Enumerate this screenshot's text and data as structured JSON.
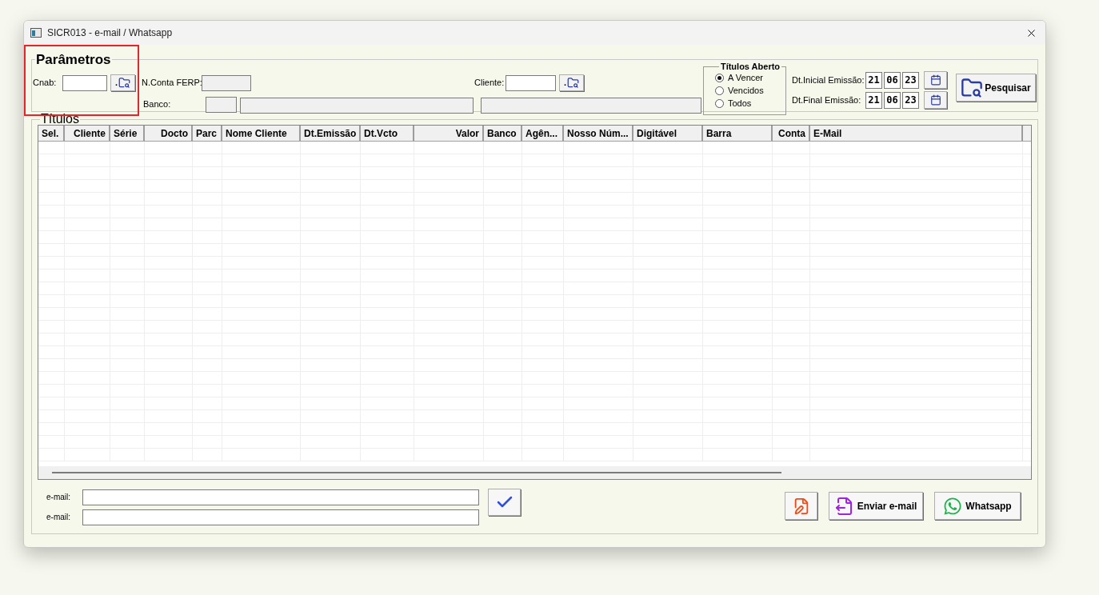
{
  "window": {
    "title": "SICR013 - e-mail / Whatsapp"
  },
  "parametros": {
    "title": "Parâmetros",
    "cnab": {
      "label": "Cnab:",
      "button": "."
    },
    "conta": {
      "label": "N.Conta FERP:"
    },
    "banco": {
      "label": "Banco:"
    },
    "cliente": {
      "label": "Cliente:",
      "button": "."
    },
    "titulos_aberto": {
      "title": "Títulos Aberto",
      "options": [
        {
          "label": "A Vencer",
          "selected": true
        },
        {
          "label": "Vencidos",
          "selected": false
        },
        {
          "label": "Todos",
          "selected": false
        }
      ]
    },
    "datas": [
      {
        "label": "Dt.Inicial Emissão:",
        "day": "21",
        "month": "06",
        "year": "23"
      },
      {
        "label": "Dt.Final Emissão:",
        "day": "21",
        "month": "06",
        "year": "23"
      }
    ],
    "search_button": "Pesquisar"
  },
  "titulos": {
    "title": "Títulos",
    "columns": [
      {
        "label": "Sel.",
        "kind": "text"
      },
      {
        "label": "Cliente",
        "kind": "number"
      },
      {
        "label": "Série",
        "kind": "text"
      },
      {
        "label": "Docto",
        "kind": "number"
      },
      {
        "label": "Parc",
        "kind": "text"
      },
      {
        "label": "Nome Cliente",
        "kind": "text"
      },
      {
        "label": "Dt.Emissão",
        "kind": "text"
      },
      {
        "label": "Dt.Vcto",
        "kind": "text"
      },
      {
        "label": "Valor",
        "kind": "number"
      },
      {
        "label": "Banco",
        "kind": "text"
      },
      {
        "label": "Agên...",
        "kind": "text"
      },
      {
        "label": "Nosso Núm...",
        "kind": "text"
      },
      {
        "label": "Digitável",
        "kind": "text"
      },
      {
        "label": "Barra",
        "kind": "text"
      },
      {
        "label": "Conta",
        "kind": "number"
      },
      {
        "label": "E-Mail",
        "kind": "text"
      }
    ]
  },
  "emails": [
    {
      "label": "e-mail:"
    },
    {
      "label": "e-mail:"
    }
  ],
  "buttons": [
    {
      "kind": "edit"
    },
    {
      "kind": "email",
      "label": "Enviar e-mail"
    },
    {
      "kind": "whatsapp",
      "label": "Whatsapp"
    }
  ]
}
